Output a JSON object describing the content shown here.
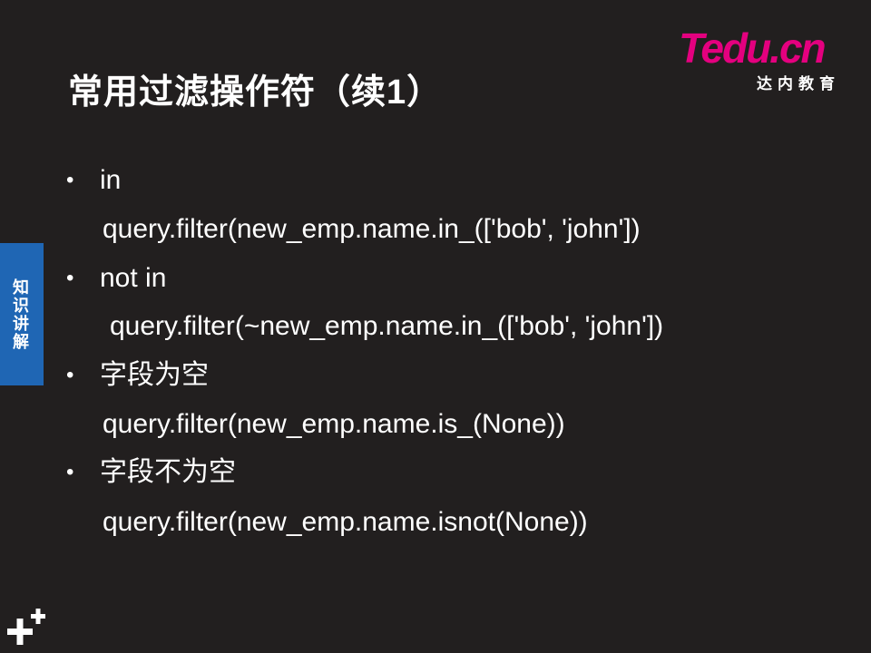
{
  "slide": {
    "title": "常用过滤操作符（续1）"
  },
  "logo": {
    "word_t": "T",
    "word_rest": "edu.cn",
    "subtitle": "达内教育"
  },
  "side_tab": {
    "label": "知识讲解",
    "color": "#1f66b4"
  },
  "items": [
    {
      "label": "in",
      "code": "query.filter(new_emp.name.in_(['bob', 'john'])"
    },
    {
      "label": "not in",
      "code": "query.filter(~new_emp.name.in_(['bob', 'john'])"
    },
    {
      "label": "字段为空",
      "code": "query.filter(new_emp.name.is_(None))"
    },
    {
      "label": "字段不为空",
      "code": "query.filter(new_emp.name.isnot(None))"
    }
  ],
  "bullet_char": "•",
  "colors": {
    "background": "#221f1f",
    "brand": "#e4007f",
    "text": "#ffffff"
  }
}
